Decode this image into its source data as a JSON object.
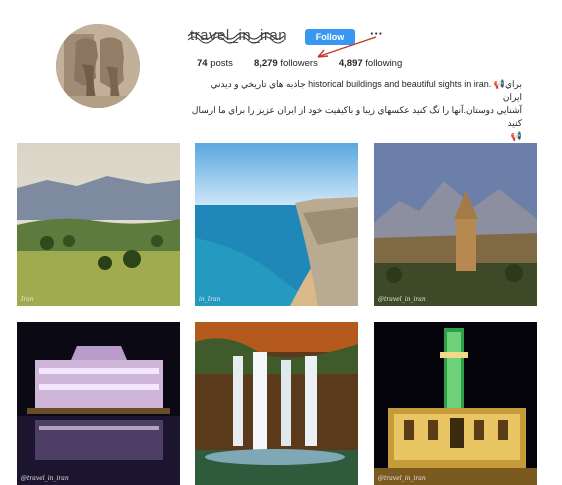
{
  "profile": {
    "username": "travel_in_iran",
    "follow_label": "Follow",
    "more_label": "···",
    "posts_count": "74",
    "posts_label": "posts",
    "followers_count": "8,279",
    "followers_label": "followers",
    "following_count": "4,897",
    "following_label": "following",
    "bio_line1": "براي📢 .historical buildings and beautiful sights in iran جاذبه هاي تاريخي و ديدني ايران",
    "bio_line2": "آشنايي دوستان.آنها را تگ كنيد عكسهاي زيبا و باكيفيت خود از ايران عزيز را براي ما ارسال كنيد",
    "bio_line3": "📢"
  },
  "posts": [
    {
      "watermark": "Iran",
      "subject": "green-plain-mountains"
    },
    {
      "watermark": "in_Iran",
      "subject": "coastal-cliff-beach"
    },
    {
      "watermark": "@travel_in_iran",
      "subject": "brick-tower-mountains"
    },
    {
      "watermark": "@travel_in_iran",
      "subject": "illuminated-palace-night"
    },
    {
      "watermark": "",
      "subject": "waterfall-autumn"
    },
    {
      "watermark": "@travel_in_iran",
      "subject": "minaret-night-lights"
    }
  ]
}
